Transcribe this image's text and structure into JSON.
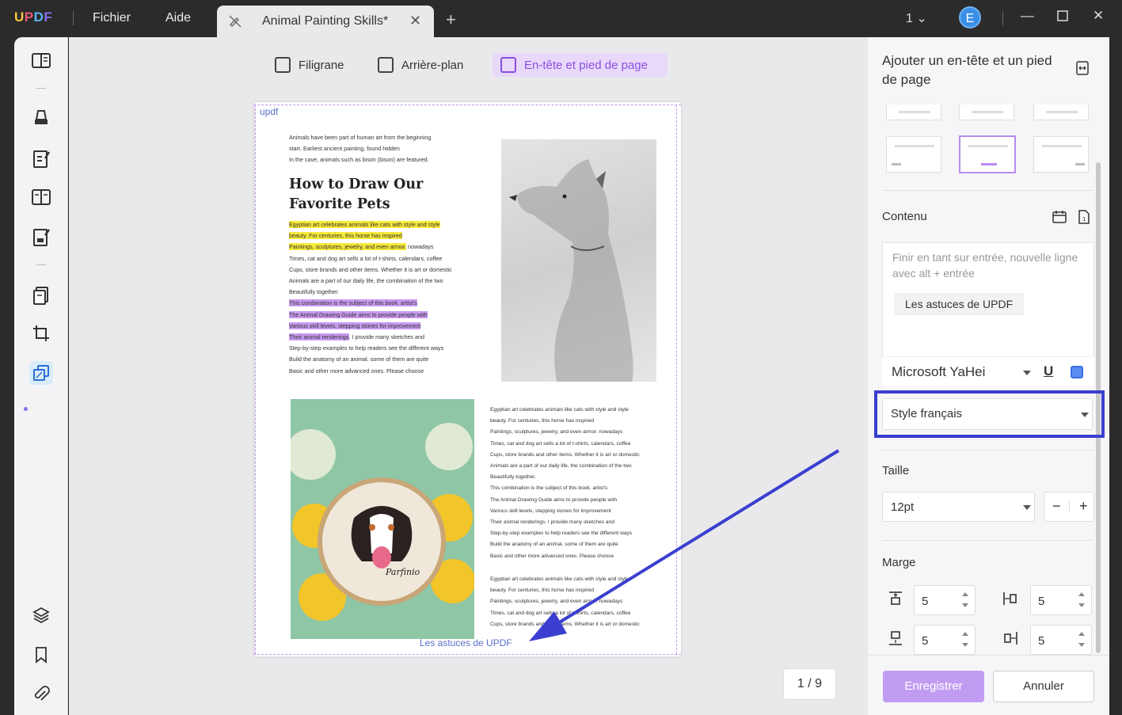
{
  "titlebar": {
    "logo": "UPDF",
    "menu": [
      "Fichier",
      "Aide"
    ],
    "tab_title": "Animal Painting Skills*",
    "page_indicator": "1",
    "avatar_letter": "E"
  },
  "toolbar": {
    "watermark": "Filigrane",
    "background": "Arrière-plan",
    "header_footer": "En-tête et pied de page"
  },
  "document": {
    "header_text": "updf",
    "footer_text": "Les astuces de UPDF",
    "intro_lines": [
      "Animals have been part of human art from the beginning",
      "start. Earliest ancient painting, found hidden",
      "In the cave, animals such as bison (bison) are featured."
    ],
    "title_line1": "How to Draw Our",
    "title_line2": "Favorite Pets",
    "hl_yellow_1": "Egyptian art celebrates animals like cats with style and style",
    "hl_yellow_2": "beauty. For centuries, this horse has inspired",
    "hl_yellow_3": "Paintings, sculptures, jewelry, and even armor.",
    "after_yellow_3": " nowadays",
    "body_lines_a": [
      "Times, cat and dog art sells a lot of t-shirts, calendars, coffee",
      "Cups, store brands and other items. Whether it is art or domestic",
      "Animals are a part of our daily life, the combination of the two",
      "Beautifully together."
    ],
    "hl_purple_1": "This combination is the subject of this book. artist's",
    "hl_purple_2": "The Animal Drawing Guide aims to provide people with",
    "hl_purple_3": "Various skill levels, stepping stones for improvement",
    "hl_purple_4": "Their animal renderings",
    "after_purple_4": ". I provide many sketches and",
    "body_lines_b": [
      "Step-by-step examples to help readers see the different ways",
      "Build the anatomy of an animal. some of them are quite",
      "Basic and other more advanced ones. Please choose"
    ],
    "right_col_1": [
      "Egyptian art celebrates animals like cats with style and style",
      "beauty. For centuries, this horse has inspired",
      "Paintings, sculptures, jewelry, and even armor. nowadays",
      "Times, cat and dog art sells a lot of t-shirts, calendars, coffee",
      "Cups, store brands and other items. Whether it is art or domestic",
      "Animals are a part of our daily life, the combination of the two",
      "Beautifully together.",
      "This combination is the subject of this book. artist's",
      "The Animal Drawing Guide aims to provide people with",
      "Various skill levels, stepping stones for improvement",
      "Their animal renderings. I provide many sketches and",
      "Step-by-step examples to help readers see the different ways",
      "Build the anatomy of an animal. some of them are quite",
      "Basic and other more advanced ones. Please choose"
    ],
    "right_col_2": [
      "Egyptian art celebrates animals like cats with style and style",
      "beauty. For centuries, this horse has inspired",
      "Paintings, sculptures, jewelry, and even armor. nowadays",
      "Times, cat and dog art sells a lot of t-shirts, calendars, coffee",
      "Cups, store brands and other items. Whether it is art or domestic"
    ],
    "embroidery_signature": "Parfinio"
  },
  "page_counter": "1 / 9",
  "panel": {
    "title": "Ajouter un en-tête et un pied de page",
    "content_label": "Contenu",
    "content_placeholder": "Finir en tant sur entrée, nouvelle ligne avec alt + entrée",
    "content_chip": "Les astuces de UPDF",
    "font_name": "Microsoft YaHei",
    "underline_label": "U",
    "style_value": "Style français",
    "size_label": "Taille",
    "size_value": "12pt",
    "stepper_minus": "−",
    "stepper_plus": "+",
    "margin_label": "Marge",
    "margin_top": "5",
    "margin_left": "5",
    "margin_bottom": "5",
    "margin_right": "5",
    "save_button": "Enregistrer",
    "cancel_button": "Annuler"
  },
  "colors": {
    "accent": "#8a4fe0",
    "highlight_box": "#3b3fcf",
    "arrow": "#3b3fcf",
    "save_button": "#c29cf2"
  }
}
